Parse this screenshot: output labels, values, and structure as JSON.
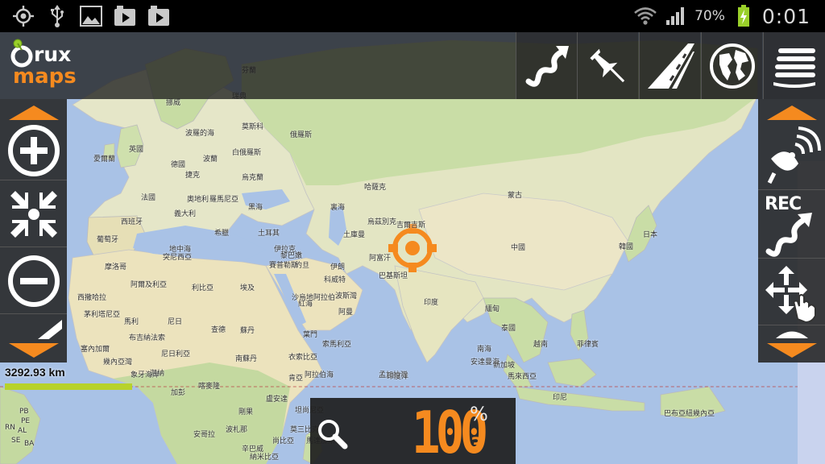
{
  "status_bar": {
    "battery_percent": "70%",
    "clock": "0:01",
    "left_icons": [
      "gps-icon",
      "usb-icon",
      "image-icon",
      "video-icon",
      "video-icon"
    ],
    "right_icons": [
      "wifi-icon",
      "signal-icon",
      "battery-charging-icon"
    ]
  },
  "app": {
    "logo_text_top": "rux",
    "logo_text_bottom": "maps",
    "brand_color": "#f58a1f"
  },
  "toolbar": {
    "buttons": [
      {
        "name": "tracks-button",
        "icon": "route-arrow-icon"
      },
      {
        "name": "waypoints-button",
        "icon": "pushpin-icon"
      },
      {
        "name": "routes-button",
        "icon": "road-icon"
      },
      {
        "name": "maps-button",
        "icon": "globe-icon"
      },
      {
        "name": "menu-button",
        "icon": "menu-layers-icon"
      }
    ]
  },
  "left_panel": {
    "buttons": [
      "zoom-in-icon",
      "center-collapse-icon",
      "zoom-out-icon",
      "ruler-icon"
    ]
  },
  "right_panel": {
    "rec_label": "REC",
    "buttons": [
      "gps-dish-icon",
      "rec-track-icon",
      "pan-hand-icon"
    ]
  },
  "scale": {
    "distance": "3292.93 km",
    "bar_color": "#b7d22b"
  },
  "zoom": {
    "value": "100",
    "unit": "%",
    "level": "3"
  },
  "map_labels": [
    "挪威",
    "瑞典",
    "芬蘭",
    "英國",
    "愛爾蘭",
    "德國",
    "波蘭",
    "白俄羅斯",
    "烏克蘭",
    "法國",
    "捷克",
    "奧地利",
    "羅馬尼亞",
    "西班牙",
    "葡萄牙",
    "義大利",
    "希臘",
    "土耳其",
    "摩洛哥",
    "突尼西亞",
    "阿爾及利亞",
    "利比亞",
    "埃及",
    "哈薩克",
    "烏茲別克",
    "吉爾吉斯",
    "土庫曼",
    "蒙古",
    "中國",
    "伊拉克",
    "伊朗",
    "阿富汗",
    "巴基斯坦",
    "沙烏地阿拉伯",
    "阿曼",
    "葉門",
    "蘇丹",
    "衣索比亞",
    "印度",
    "緬甸",
    "泰國",
    "越南",
    "菲律賓",
    "馬來西亞",
    "印尼",
    "日本",
    "韓國",
    "西撒哈拉",
    "茅利塔尼亞",
    "馬利",
    "尼日",
    "查德",
    "尼日利亞",
    "南蘇丹",
    "喀麥隆",
    "肯亞",
    "坦尚尼亞",
    "剛果",
    "安哥拉",
    "納米比亞",
    "尚比亞",
    "馬達加斯加",
    "巴布亞紐幾內亞",
    "孟加拉灣",
    "阿拉伯海",
    "南海",
    "安達曼海",
    "幾內亞灣",
    "新加坡",
    "RN",
    "PB",
    "PE",
    "AL",
    "SE",
    "BA",
    "波羅的海",
    "莫斯科",
    "俄羅斯",
    "賽普勒斯",
    "黎巴嫩",
    "約旦",
    "科威特",
    "塞內加爾",
    "布吉納法索",
    "象牙海岸",
    "迦納",
    "加彭",
    "索馬利亞",
    "盧安達",
    "莫三比克",
    "辛巴威",
    "波札那",
    "裏海",
    "黑海",
    "地中海",
    "紅海",
    "波斯灣",
    "印度洋"
  ]
}
